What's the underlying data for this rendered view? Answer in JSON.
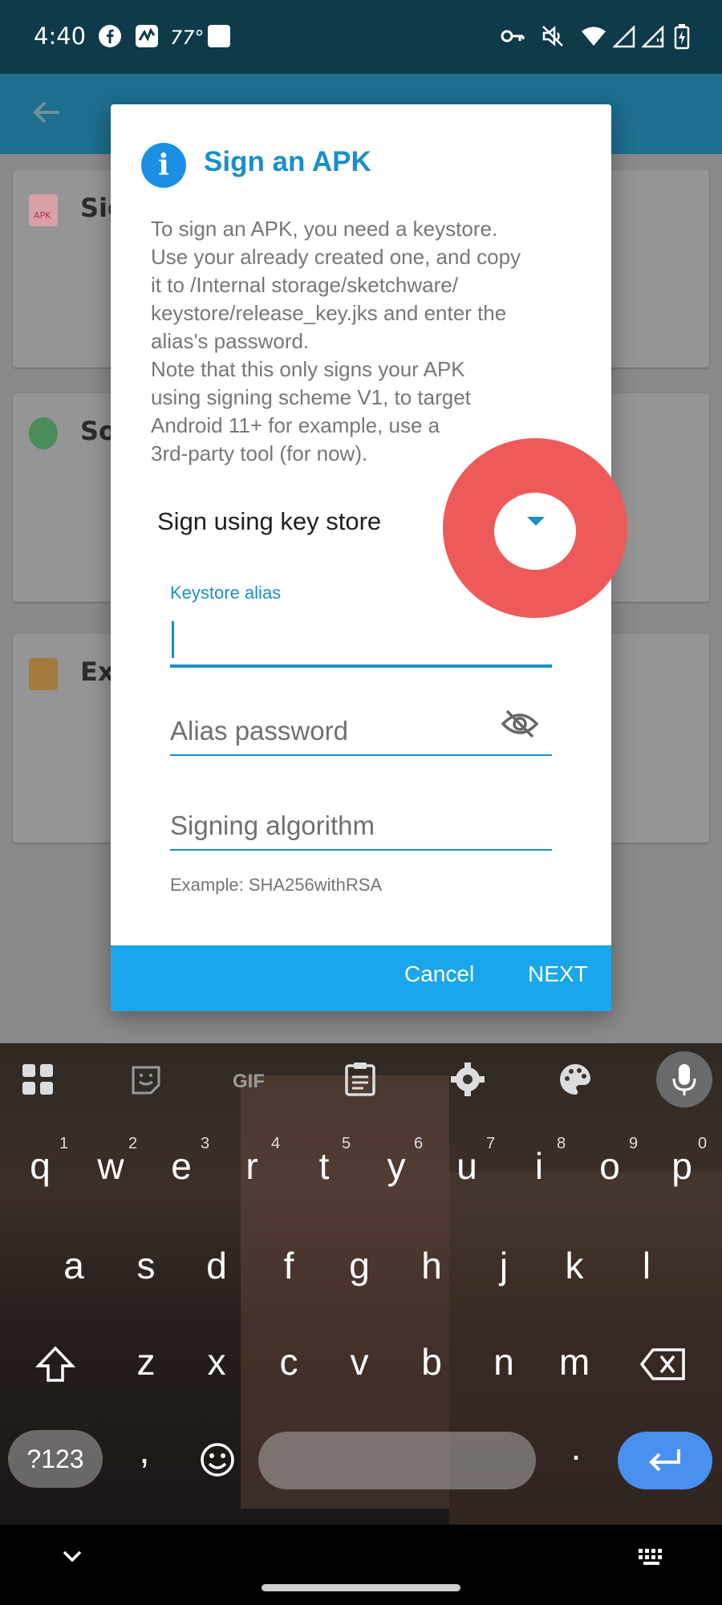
{
  "status_bar": {
    "time": "4:40",
    "temperature": "77°",
    "icons": [
      "facebook-icon",
      "app-icon",
      "square-icon",
      "vpn-key-icon",
      "mute-icon",
      "wifi-icon",
      "signal-icon",
      "signal-icon",
      "battery-icon"
    ]
  },
  "app": {
    "cards": [
      {
        "title": "Sig",
        "icon": "apk-file-icon"
      },
      {
        "title": "So",
        "icon": "android-icon"
      },
      {
        "title": "Ex",
        "icon": "package-icon"
      }
    ]
  },
  "dialog": {
    "title": "Sign an APK",
    "message": "To sign an APK, you need a keystore.\nUse your already created one, and copy\nit to /Internal storage/sketchware/\nkeystore/release_key.jks and enter the\nalias's password.\nNote that this only signs your APK\nusing signing scheme V1, to target\nAndroid 11+ for example, use a\n3rd-party tool (for now).",
    "spinner_label": "Sign using key store",
    "alias_label": "Keystore alias",
    "alias_value": "",
    "password_hint": "Alias password",
    "algorithm_hint": "Signing algorithm",
    "algorithm_helper": "Example: SHA256withRSA",
    "cancel": "Cancel",
    "next": "NEXT",
    "accent": "#1a8fc8",
    "footer_color": "#1aa6ec"
  },
  "keyboard": {
    "toolbar": [
      "apps-icon",
      "sticker-icon",
      "GIF",
      "clipboard-icon",
      "settings-icon",
      "palette-icon",
      "mic-icon"
    ],
    "row1": [
      "q",
      "w",
      "e",
      "r",
      "t",
      "y",
      "u",
      "i",
      "o",
      "p"
    ],
    "row1_hints": [
      "1",
      "2",
      "3",
      "4",
      "5",
      "6",
      "7",
      "8",
      "9",
      "0"
    ],
    "row2": [
      "a",
      "s",
      "d",
      "f",
      "g",
      "h",
      "j",
      "k",
      "l"
    ],
    "row3": [
      "z",
      "x",
      "c",
      "v",
      "b",
      "n",
      "m"
    ],
    "symbols_key": "?123",
    "comma": ",",
    "period": "."
  }
}
